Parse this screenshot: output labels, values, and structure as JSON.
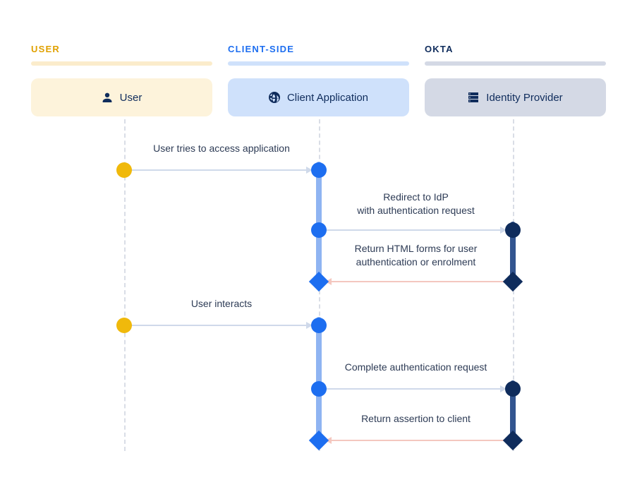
{
  "lanes": {
    "user": {
      "heading": "USER",
      "actor": "User"
    },
    "client": {
      "heading": "CLIENT-SIDE",
      "actor": "Client Application"
    },
    "okta": {
      "heading": "OKTA",
      "actor": "Identity Provider"
    }
  },
  "messages": {
    "m1": "User tries to access application",
    "m2a": "Redirect to IdP",
    "m2b": "with authentication request",
    "m3a": "Return HTML forms for user",
    "m3b": "authentication or enrolment",
    "m4": "User interacts",
    "m5": "Complete authentication request",
    "m6": "Return assertion to client"
  }
}
